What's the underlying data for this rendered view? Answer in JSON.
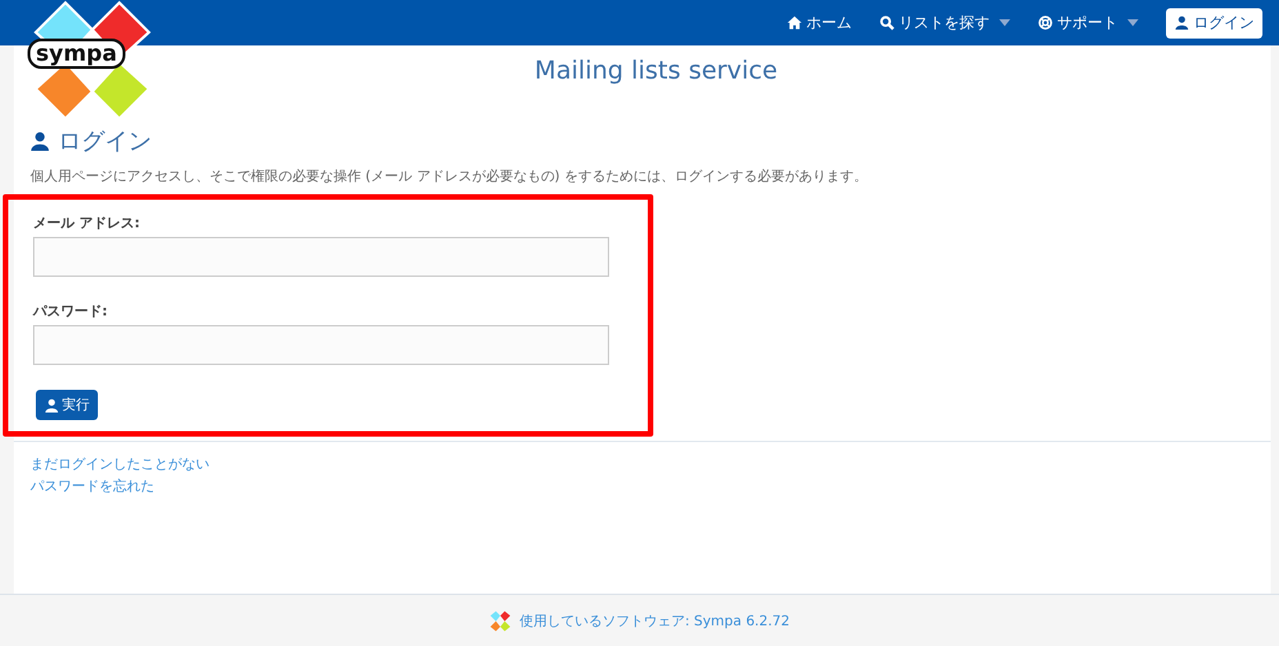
{
  "logo": {
    "text": "sympa"
  },
  "nav": [
    {
      "label": "ホーム",
      "dropdown": false
    },
    {
      "label": "リストを探す",
      "dropdown": true
    },
    {
      "label": "サポート",
      "dropdown": true
    }
  ],
  "login_button": "ログイン",
  "site_title": "Mailing lists service",
  "heading": "ログイン",
  "description": "個人用ページにアクセスし、そこで権限の必要な操作 (メール アドレスが必要なもの) をするためには、ログインする必要があります。",
  "form": {
    "fields": [
      {
        "label": "メール アドレス:"
      },
      {
        "label": "パスワード:"
      }
    ],
    "submit": "実行",
    "highlighted": true
  },
  "links": [
    "まだログインしたことがない",
    "パスワードを忘れた"
  ],
  "footer": "使用しているソフトウェア: Sympa 6.2.72"
}
